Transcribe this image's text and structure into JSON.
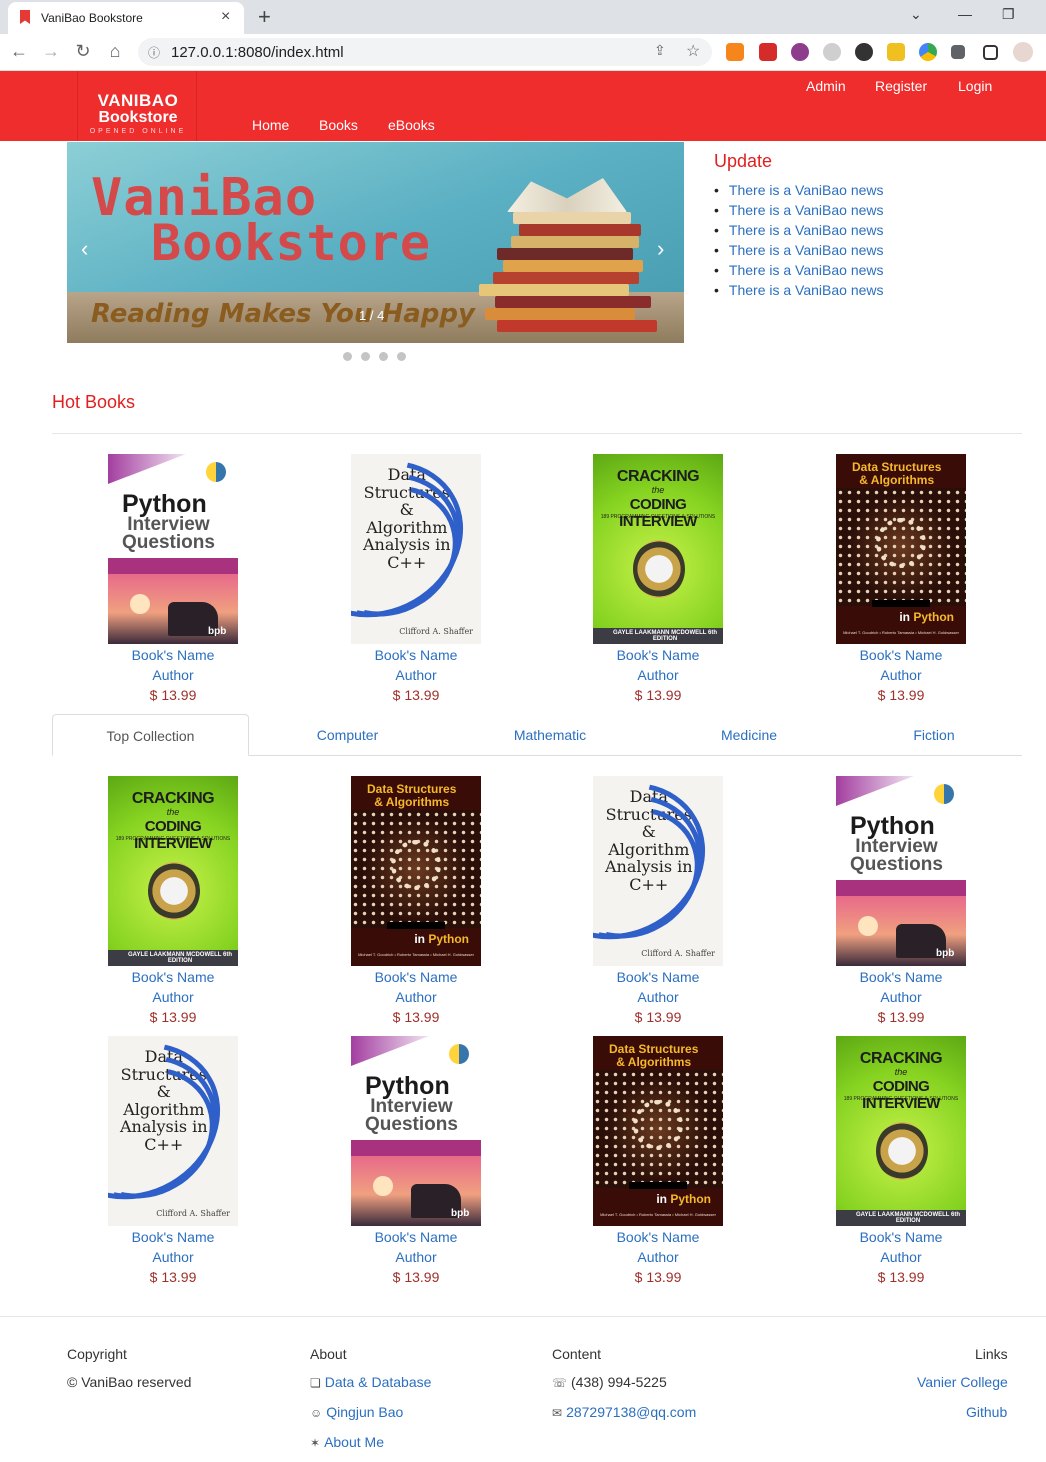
{
  "browser": {
    "tab_title": "VaniBao Bookstore",
    "url": "127.0.0.1:8080/index.html"
  },
  "header": {
    "logo_line1": "VANIBAO",
    "logo_line2": "Bookstore",
    "logo_line3": "OPENED ONLINE",
    "main_nav": [
      "Home",
      "Books",
      "eBooks"
    ],
    "top_nav": [
      "Admin",
      "Register",
      "Login"
    ]
  },
  "carousel": {
    "title_line1": "VaniBao",
    "title_line2": "Bookstore",
    "tagline": "Reading Makes You Happy",
    "counter": "1 / 4",
    "prev": "‹",
    "next": "›",
    "slides": 4,
    "current": 1
  },
  "updates": {
    "title": "Update",
    "items": [
      "There is a VaniBao news",
      "There is a VaniBao news",
      "There is a VaniBao news",
      "There is a VaniBao news",
      "There is a VaniBao news",
      "There is a VaniBao news"
    ]
  },
  "hot_books": {
    "title": "Hot Books",
    "items": [
      {
        "name": "Book's Name",
        "author": "Author",
        "price": "$ 13.99",
        "cover": "python"
      },
      {
        "name": "Book's Name",
        "author": "Author",
        "price": "$ 13.99",
        "cover": "ds"
      },
      {
        "name": "Book's Name",
        "author": "Author",
        "price": "$ 13.99",
        "cover": "crack"
      },
      {
        "name": "Book's Name",
        "author": "Author",
        "price": "$ 13.99",
        "cover": "dsa"
      }
    ]
  },
  "category_tabs": [
    "Top Collection",
    "Computer",
    "Mathematic",
    "Medicine",
    "Fiction"
  ],
  "collection": {
    "items": [
      {
        "name": "Book's Name",
        "author": "Author",
        "price": "$ 13.99",
        "cover": "crack"
      },
      {
        "name": "Book's Name",
        "author": "Author",
        "price": "$ 13.99",
        "cover": "dsa"
      },
      {
        "name": "Book's Name",
        "author": "Author",
        "price": "$ 13.99",
        "cover": "ds"
      },
      {
        "name": "Book's Name",
        "author": "Author",
        "price": "$ 13.99",
        "cover": "python"
      },
      {
        "name": "Book's Name",
        "author": "Author",
        "price": "$ 13.99",
        "cover": "ds"
      },
      {
        "name": "Book's Name",
        "author": "Author",
        "price": "$ 13.99",
        "cover": "python"
      },
      {
        "name": "Book's Name",
        "author": "Author",
        "price": "$ 13.99",
        "cover": "dsa"
      },
      {
        "name": "Book's Name",
        "author": "Author",
        "price": "$ 13.99",
        "cover": "crack"
      }
    ]
  },
  "covers": {
    "python": {
      "l1": "Python",
      "l2": "Interview",
      "l3": "Questions",
      "tag": "bpb"
    },
    "ds": {
      "text": "Data\nStructures\n&\nAlgorithm\nAnalysis in\nC++",
      "author": "Clifford A. Shaffer"
    },
    "crack": {
      "l1": "CRACKING",
      "l2": "the",
      "l3": "CODING INTERVIEW",
      "l4": "189 PROGRAMMING QUESTIONS & SOLUTIONS",
      "author": "GAYLE LAAKMANN MCDOWELL 6th EDITION"
    },
    "dsa": {
      "l1": "Data Structures",
      "l2": "& Algorithms",
      "in": "in",
      "py": "Python",
      "authors": "Michael T. Goodrich • Roberto Tamassia • Michael H. Goldwasser"
    }
  },
  "footer": {
    "copyright_h": "Copyright",
    "copyright_v": "© VaniBao reserved",
    "about_h": "About",
    "about_items": [
      "Data & Database",
      "Qingjun Bao",
      "About Me"
    ],
    "content_h": "Content",
    "phone": "(438) 994-5225",
    "email": "287297138@qq.com",
    "links_h": "Links",
    "links": [
      "Vanier College",
      "Github"
    ]
  },
  "colors": {
    "brand_red": "#ef2d2d",
    "link_blue": "#2b6fc0",
    "price_red": "#a0302a"
  }
}
